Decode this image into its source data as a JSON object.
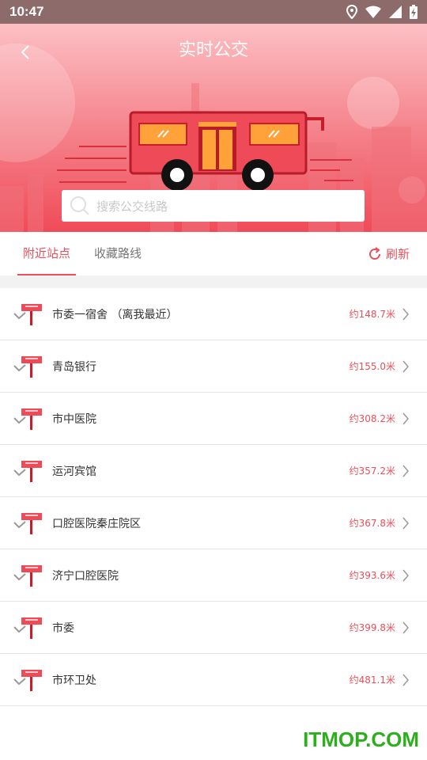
{
  "status": {
    "time": "10:47"
  },
  "header": {
    "title": "实时公交"
  },
  "search": {
    "placeholder": "搜索公交线路"
  },
  "tabs": [
    {
      "label": "附近站点",
      "active": true
    },
    {
      "label": "收藏路线",
      "active": false
    }
  ],
  "refresh": {
    "label": "刷新"
  },
  "stops": [
    {
      "name": "市委一宿舍 （离我最近）",
      "distance": "约148.7米"
    },
    {
      "name": "青岛银行",
      "distance": "约155.0米"
    },
    {
      "name": "市中医院",
      "distance": "约308.2米"
    },
    {
      "name": "运河宾馆",
      "distance": "约357.2米"
    },
    {
      "name": "口腔医院秦庄院区",
      "distance": "约367.8米"
    },
    {
      "name": "济宁口腔医院",
      "distance": "约393.6米"
    },
    {
      "name": "市委",
      "distance": "约399.8米"
    },
    {
      "name": "市环卫处",
      "distance": "约481.1米"
    }
  ],
  "watermark": "ITMOP.COM",
  "colors": {
    "accent": "#e8505b",
    "header_top": "#fcc0c4",
    "header_bottom": "#ef4b58"
  }
}
